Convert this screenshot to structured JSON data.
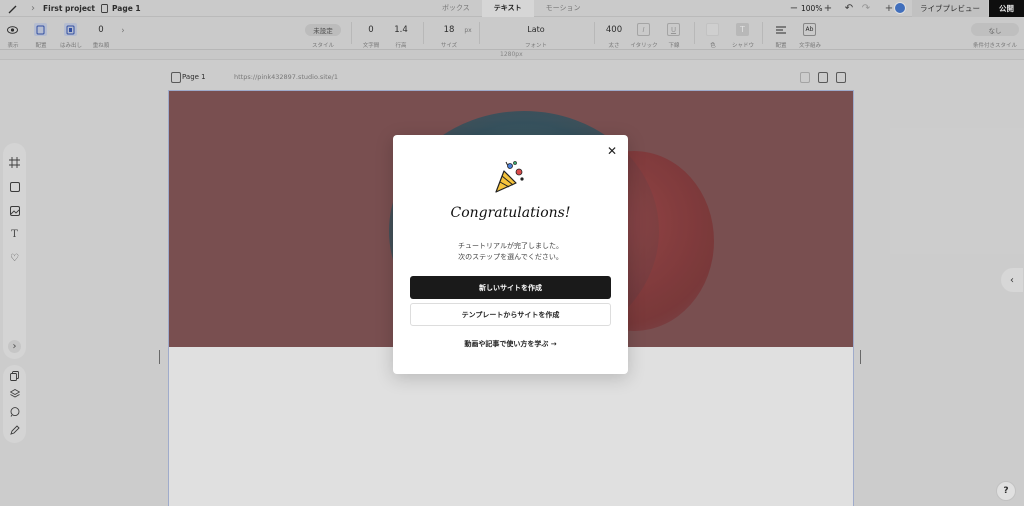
{
  "topbar": {
    "project": "First project",
    "page": "Page 1",
    "tabs": [
      {
        "label": "ボックス",
        "active": false
      },
      {
        "label": "テキスト",
        "active": true
      },
      {
        "label": "モーション",
        "active": false
      }
    ],
    "zoom": "100%",
    "live_preview": "ライブプレビュー",
    "publish": "公開"
  },
  "toolbar": {
    "display_label": "表示",
    "layout_label": "配置",
    "overflow_label": "はみ出し",
    "stack_value": "0",
    "stack_label": "重ね順",
    "style_value": "未設定",
    "style_label": "スタイル",
    "letter_spacing_value": "0",
    "letter_spacing_label": "文字間",
    "line_height_value": "1.4",
    "line_height_label": "行高",
    "size_value": "18",
    "size_unit": "px",
    "size_label": "サイズ",
    "font_value": "Lato",
    "font_label": "フォント",
    "weight_value": "400",
    "weight_label": "太さ",
    "italic_label": "イタリック",
    "underline_label": "下線",
    "color_label": "色",
    "shadow_label": "シャドウ",
    "align_label": "配置",
    "wrap_label": "文字組み",
    "conditional_value": "なし",
    "conditional_label": "条件付きスタイル"
  },
  "ruler": {
    "label": "1280px"
  },
  "page_header": {
    "title": "Page 1",
    "url": "https://pink432897.studio.site/1"
  },
  "modal": {
    "title": "Congratulations!",
    "message_line1": "チュートリアルが完了しました。",
    "message_line2": "次のステップを選んでください。",
    "primary_button": "新しいサイトを作成",
    "secondary_button": "テンプレートからサイトを作成",
    "learn_link": "動画や記事で使い方を学ぶ →"
  },
  "help": {
    "label": "?"
  },
  "colors": {
    "hero": "#8a5a5c",
    "publish_bg": "#111111",
    "primary_button_bg": "#1a1a1a",
    "frame_border": "#b5c3e8"
  }
}
